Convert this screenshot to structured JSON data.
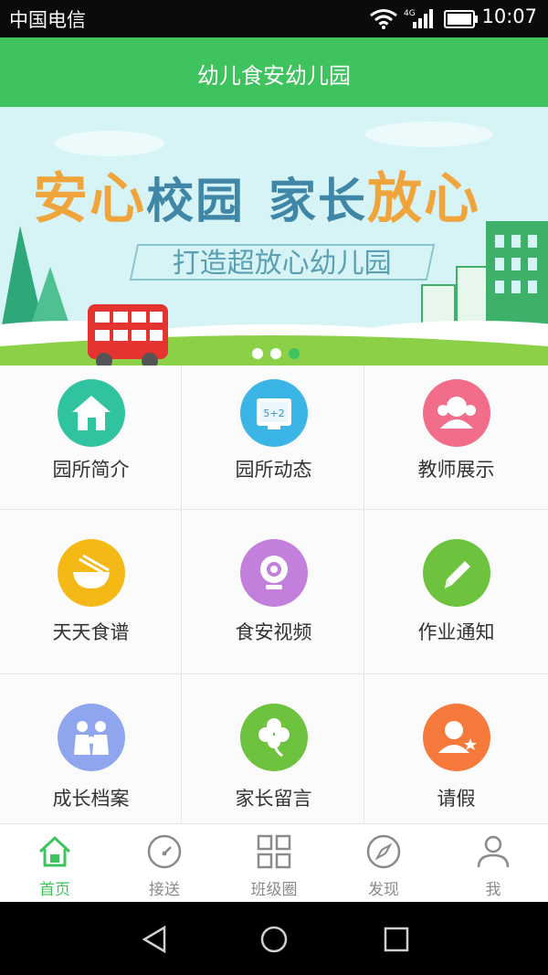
{
  "status_bar": {
    "carrier": "中国电信",
    "network": "4G",
    "time": "10:07"
  },
  "header": {
    "title": "幼儿食安幼儿园"
  },
  "banner": {
    "headline_part1_orange": "安心",
    "headline_part1_blue": "校园",
    "headline_part2_blue": "家长",
    "headline_part2_orange": "放心",
    "subline": "打造超放心幼儿园",
    "slides": 3,
    "active_slide": 3
  },
  "grid": {
    "items": [
      {
        "label": "园所简介",
        "icon": "school-house-icon",
        "color": "#2fc3a0"
      },
      {
        "label": "园所动态",
        "icon": "blackboard-icon",
        "color": "#3ab5e6"
      },
      {
        "label": "教师展示",
        "icon": "teachers-icon",
        "color": "#f26d8a"
      },
      {
        "label": "天天食谱",
        "icon": "food-bowl-icon",
        "color": "#f5b916"
      },
      {
        "label": "食安视频",
        "icon": "webcam-icon",
        "color": "#c27fdc"
      },
      {
        "label": "作业通知",
        "icon": "pencil-icon",
        "color": "#6dc23e"
      },
      {
        "label": "成长档案",
        "icon": "family-icon",
        "color": "#8fa6ef"
      },
      {
        "label": "家长留言",
        "icon": "clover-icon",
        "color": "#6dc23e"
      },
      {
        "label": "请假",
        "icon": "person-star-icon",
        "color": "#f5793b"
      }
    ]
  },
  "bottom_nav": {
    "items": [
      {
        "label": "首页",
        "icon": "home-icon",
        "active": true
      },
      {
        "label": "接送",
        "icon": "pickup-dial-icon",
        "active": false
      },
      {
        "label": "班级圈",
        "icon": "grid-icon",
        "active": false
      },
      {
        "label": "发现",
        "icon": "compass-icon",
        "active": false
      },
      {
        "label": "我",
        "icon": "profile-icon",
        "active": false
      }
    ]
  },
  "colors": {
    "accent": "#3fc35f",
    "banner_sky": "#d6f3f6",
    "headline_orange": "#f0a53c",
    "headline_blue": "#3f86a7"
  }
}
